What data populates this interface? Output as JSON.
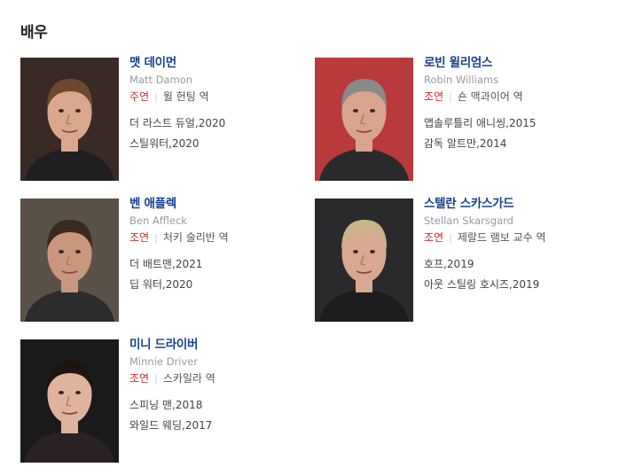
{
  "section": {
    "title": "배우"
  },
  "actors": [
    {
      "name": "맷 데이먼",
      "name_en": "Matt Damon",
      "role": "주연",
      "character": "윌 헌팅 역",
      "works": [
        {
          "title": "더 라스트 듀얼",
          "year": "2020"
        },
        {
          "title": "스틸워터",
          "year": "2020"
        }
      ],
      "photo": {
        "bg": "#3a2a26",
        "skin": "#d9a88c",
        "hair": "#6b4a2e",
        "shirt": "#1f1f22"
      }
    },
    {
      "name": "로빈 윌리엄스",
      "name_en": "Robin Williams",
      "role": "조연",
      "character": "숀 맥과이어 역",
      "works": [
        {
          "title": "앱솔루틀리 애니씽",
          "year": "2015"
        },
        {
          "title": "감독 알트만",
          "year": "2014"
        }
      ],
      "photo": {
        "bg": "#b83a3a",
        "skin": "#d9a48e",
        "hair": "#8a8a88",
        "shirt": "#2a2a2a"
      }
    },
    {
      "name": "벤 애플렉",
      "name_en": "Ben Affleck",
      "role": "조연",
      "character": "처키 술리반 역",
      "works": [
        {
          "title": "더 배트맨",
          "year": "2021"
        },
        {
          "title": "딥 워터",
          "year": "2020"
        }
      ],
      "photo": {
        "bg": "#5a5248",
        "skin": "#c9987c",
        "hair": "#3a2a20",
        "shirt": "#2c2c2e"
      }
    },
    {
      "name": "스텔란 스카스가드",
      "name_en": "Stellan Skarsgard",
      "role": "조연",
      "character": "제랄드 램보 교수 역",
      "works": [
        {
          "title": "호프",
          "year": "2019"
        },
        {
          "title": "아웃 스틸링 호시즈",
          "year": "2019"
        }
      ],
      "photo": {
        "bg": "#2a2a2c",
        "skin": "#d8a890",
        "hair": "#c9b48a",
        "shirt": "#1c1c1e"
      }
    },
    {
      "name": "미니 드라이버",
      "name_en": "Minnie Driver",
      "role": "조연",
      "character": "스카일라 역",
      "works": [
        {
          "title": "스피닝 맨",
          "year": "2018"
        },
        {
          "title": "와일드 웨딩",
          "year": "2017"
        }
      ],
      "photo": {
        "bg": "#1a1a1a",
        "skin": "#e0b49c",
        "hair": "#1e1410",
        "shirt": "#2a2222"
      }
    }
  ]
}
